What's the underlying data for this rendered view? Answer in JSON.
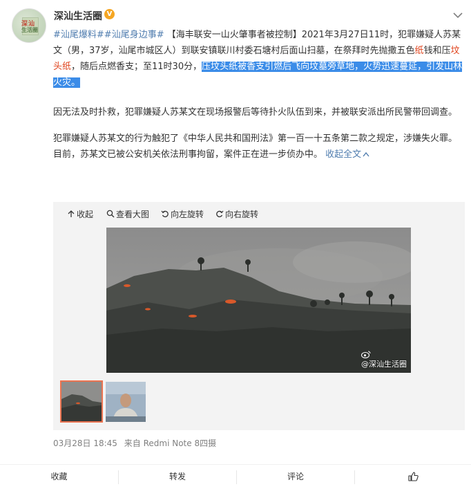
{
  "account": {
    "name": "深汕生活圈",
    "badge": "V"
  },
  "avatar_text": {
    "line1": "深汕",
    "line2": "生活圈"
  },
  "post": {
    "tag1": "#汕尾爆料#",
    "tag2": "#汕尾身边事#",
    "p1a": "【海丰联安一山火肇事者被控制】2021年3月27日11时，犯罪嫌疑人苏某文（男，37岁，汕尾市城区人）到联安镇联川村委石塘村后面山扫墓，在祭拜时先抛撒五色",
    "p1_red1": "纸",
    "p1b": "钱和压",
    "p1_red2": "坟头纸",
    "p1c": "，随后点燃香支；至11时30分，",
    "p1_highlight": "压坟头纸被香支引燃后飞向坟墓旁草地，火势迅速蔓延，引发山林火灾。",
    "p2": "因无法及时扑救，犯罪嫌疑人苏某文在现场报警后等待扑火队伍到来，并被联安派出所民警带回调查。",
    "p3": "犯罪嫌疑人苏某文的行为触犯了《中华人民共和国刑法》第一百一十五条第二款之规定，涉嫌失火罪。目前，苏某文已被公安机关依法刑事拘留，案件正在进一步侦办中。",
    "collapse": "收起全文"
  },
  "media_toolbar": {
    "collapse": "收起",
    "view_large": "查看大图",
    "rotate_left": "向左旋转",
    "rotate_right": "向右旋转"
  },
  "image_watermark": "@深汕生活圈",
  "meta": {
    "date": "03月28日 18:45",
    "source": "来自 Redmi Note 8四摄"
  },
  "actions": {
    "favorite": "收藏",
    "repost": "转发",
    "comment": "评论"
  },
  "icons": [
    "verified-badge-icon",
    "chevron-down-icon",
    "collapse-arrow-icon",
    "magnifier-icon",
    "rotate-left-icon",
    "rotate-right-icon",
    "weibo-logo-icon",
    "like-icon"
  ],
  "colors": {
    "link": "#507daf",
    "highlight": "#3b8ce8",
    "red_text": "#e0441d",
    "badge": "#f5a623",
    "thumb_border": "#eb7350"
  }
}
